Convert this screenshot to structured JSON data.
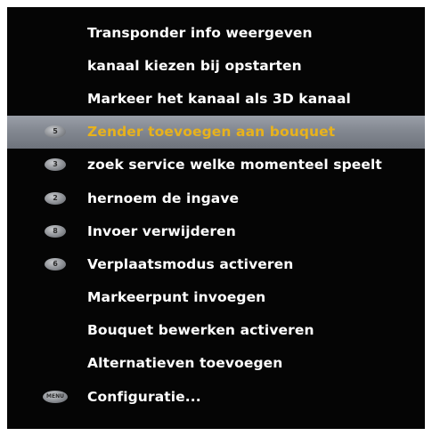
{
  "menu": {
    "items": [
      {
        "label": "Transponder info weergeven",
        "key": "",
        "selected": false
      },
      {
        "label": "kanaal kiezen bij opstarten",
        "key": "",
        "selected": false
      },
      {
        "label": "Markeer het kanaal als 3D kanaal",
        "key": "",
        "selected": false
      },
      {
        "label": "Zender toevoegen aan bouquet",
        "key": "5",
        "selected": true
      },
      {
        "label": "zoek service welke momenteel speelt",
        "key": "3",
        "selected": false
      },
      {
        "label": "hernoem de ingave",
        "key": "2",
        "selected": false
      },
      {
        "label": "Invoer verwijderen",
        "key": "8",
        "selected": false
      },
      {
        "label": "Verplaatsmodus activeren",
        "key": "6",
        "selected": false
      },
      {
        "label": "Markeerpunt invoegen",
        "key": "",
        "selected": false
      },
      {
        "label": "Bouquet bewerken activeren",
        "key": "",
        "selected": false
      },
      {
        "label": "Alternatieven toevoegen",
        "key": "",
        "selected": false
      },
      {
        "label": "Configuratie...",
        "key": "MENU",
        "selected": false
      }
    ]
  },
  "colors": {
    "background": "#050505",
    "text": "#ffffff",
    "selected_text": "#e8b21c",
    "selected_bar": "#838891"
  }
}
